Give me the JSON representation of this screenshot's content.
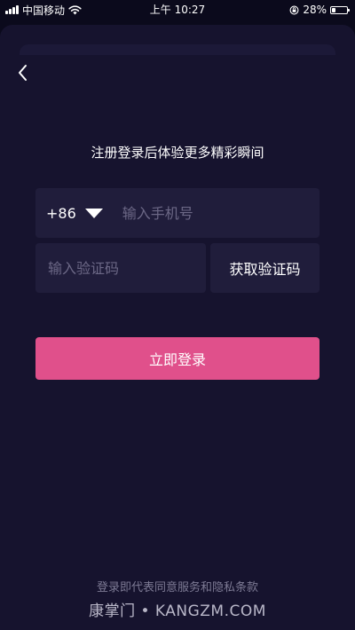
{
  "status_bar": {
    "carrier": "中国移动",
    "time": "上午 10:27",
    "battery_text": "28%",
    "battery_level": 0.28,
    "icons": [
      "signal-icon",
      "wifi-icon",
      "orientation-lock-icon",
      "battery-icon"
    ]
  },
  "header": {
    "back_icon": "chevron-left-icon"
  },
  "main": {
    "headline": "注册登录后体验更多精彩瞬间",
    "phone": {
      "country_code": "+86",
      "dropdown_icon": "triangle-down-icon",
      "placeholder": "输入手机号",
      "value": ""
    },
    "code": {
      "placeholder": "输入验证码",
      "value": "",
      "get_code_label": "获取验证码"
    },
    "login_label": "立即登录"
  },
  "footer": {
    "terms": "登录即代表同意服务和隐私条款",
    "watermark": "康掌门 • KANGZM.COM"
  },
  "colors": {
    "background": "#0b0a1c",
    "sheet": "#16132e",
    "field": "#201d3b",
    "accent": "#e0508b",
    "placeholder": "#6c6886"
  }
}
